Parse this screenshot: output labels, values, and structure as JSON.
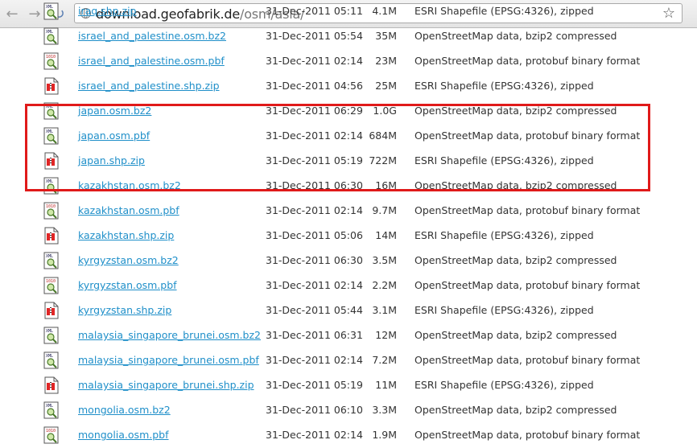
{
  "browser": {
    "url_host": "download.geofabrik.de",
    "url_path": "/osm/asia/"
  },
  "rows": [
    {
      "name": "iraq.shp.zip",
      "date": "31-Dec-2011 05:11",
      "size": "4.1M",
      "desc": "ESRI Shapefile (EPSG:4326), zipped",
      "icon": "compressed-icon"
    },
    {
      "name": "israel_and_palestine.osm.bz2",
      "date": "31-Dec-2011 05:54",
      "size": "35M",
      "desc": "OpenStreetMap data, bzip2 compressed",
      "icon": "compressed-icon"
    },
    {
      "name": "israel_and_palestine.osm.pbf",
      "date": "31-Dec-2011 02:14",
      "size": "23M",
      "desc": "OpenStreetMap data, protobuf binary format",
      "icon": "binary-icon"
    },
    {
      "name": "israel_and_palestine.shp.zip",
      "date": "31-Dec-2011 04:56",
      "size": "25M",
      "desc": "ESRI Shapefile (EPSG:4326), zipped",
      "icon": "archive-icon"
    },
    {
      "name": "japan.osm.bz2",
      "date": "31-Dec-2011 06:29",
      "size": "1.0G",
      "desc": "OpenStreetMap data, bzip2 compressed",
      "icon": "compressed-icon"
    },
    {
      "name": "japan.osm.pbf",
      "date": "31-Dec-2011 02:14",
      "size": "684M",
      "desc": "OpenStreetMap data, protobuf binary format",
      "icon": "compressed-icon"
    },
    {
      "name": "japan.shp.zip",
      "date": "31-Dec-2011 05:19",
      "size": "722M",
      "desc": "ESRI Shapefile (EPSG:4326), zipped",
      "icon": "archive-icon"
    },
    {
      "name": "kazakhstan.osm.bz2",
      "date": "31-Dec-2011 06:30",
      "size": "16M",
      "desc": "OpenStreetMap data, bzip2 compressed",
      "icon": "compressed-icon"
    },
    {
      "name": "kazakhstan.osm.pbf",
      "date": "31-Dec-2011 02:14",
      "size": "9.7M",
      "desc": "OpenStreetMap data, protobuf binary format",
      "icon": "binary-icon"
    },
    {
      "name": "kazakhstan.shp.zip",
      "date": "31-Dec-2011 05:06",
      "size": "14M",
      "desc": "ESRI Shapefile (EPSG:4326), zipped",
      "icon": "archive-icon"
    },
    {
      "name": "kyrgyzstan.osm.bz2",
      "date": "31-Dec-2011 06:30",
      "size": "3.5M",
      "desc": "OpenStreetMap data, bzip2 compressed",
      "icon": "compressed-icon"
    },
    {
      "name": "kyrgyzstan.osm.pbf",
      "date": "31-Dec-2011 02:14",
      "size": "2.2M",
      "desc": "OpenStreetMap data, protobuf binary format",
      "icon": "binary-icon"
    },
    {
      "name": "kyrgyzstan.shp.zip",
      "date": "31-Dec-2011 05:44",
      "size": "3.1M",
      "desc": "ESRI Shapefile (EPSG:4326), zipped",
      "icon": "archive-icon"
    },
    {
      "name": "malaysia_singapore_brunei.osm.bz2",
      "date": "31-Dec-2011 06:31",
      "size": "12M",
      "desc": "OpenStreetMap data, bzip2 compressed",
      "icon": "compressed-icon"
    },
    {
      "name": "malaysia_singapore_brunei.osm.pbf",
      "date": "31-Dec-2011 02:14",
      "size": "7.2M",
      "desc": "OpenStreetMap data, protobuf binary format",
      "icon": "compressed-icon"
    },
    {
      "name": "malaysia_singapore_brunei.shp.zip",
      "date": "31-Dec-2011 05:19",
      "size": "11M",
      "desc": "ESRI Shapefile (EPSG:4326), zipped",
      "icon": "archive-icon"
    },
    {
      "name": "mongolia.osm.bz2",
      "date": "31-Dec-2011 06:10",
      "size": "3.3M",
      "desc": "OpenStreetMap data, bzip2 compressed",
      "icon": "compressed-icon"
    },
    {
      "name": "mongolia.osm.pbf",
      "date": "31-Dec-2011 02:14",
      "size": "1.9M",
      "desc": "OpenStreetMap data, protobuf binary format",
      "icon": "binary-icon"
    }
  ],
  "colors": {
    "link": "#1f8fc9",
    "highlight_border": "#e01a1a"
  }
}
